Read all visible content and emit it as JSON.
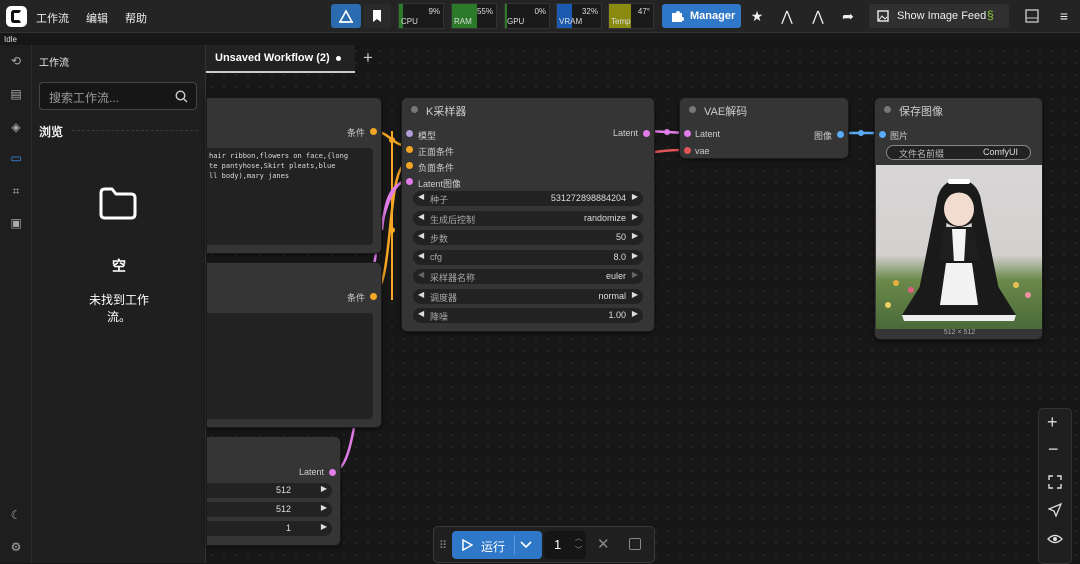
{
  "status": "Idle",
  "menu": {
    "workflow": "工作流",
    "edit": "编辑",
    "help": "帮助"
  },
  "stats": [
    {
      "label": "CPU",
      "value": "9%",
      "fill": 0.09,
      "color": "#2a7a2a"
    },
    {
      "label": "RAM",
      "value": "55%",
      "fill": 0.55,
      "color": "#2a7a2a"
    },
    {
      "label": "GPU",
      "value": "0%",
      "fill": 0.0,
      "color": "#2a7a2a"
    },
    {
      "label": "VRAM",
      "value": "32%",
      "fill": 0.32,
      "color": "#1a5ab0"
    },
    {
      "label": "Temp",
      "value": "47°",
      "fill": 0.47,
      "color": "#8a8a10"
    }
  ],
  "manager_label": "Manager",
  "feed_label": "Show Image Feed",
  "sidebar": {
    "title": "工作流",
    "search_placeholder": "搜索工作流...",
    "browse": "浏览",
    "empty_title": "空",
    "empty_message": "未找到工作流。"
  },
  "tab": {
    "title": "Unsaved Workflow (2)",
    "add": "+"
  },
  "nodes": {
    "ksampler": {
      "title": "K采样器",
      "inputs": [
        "模型",
        "正面条件",
        "负面条件",
        "Latent图像"
      ],
      "output": "Latent",
      "widgets": [
        {
          "name": "种子",
          "value": "531272898884204"
        },
        {
          "name": "生成后控制",
          "value": "randomize"
        },
        {
          "name": "步数",
          "value": "50"
        },
        {
          "name": "cfg",
          "value": "8.0"
        },
        {
          "name": "采样器名称",
          "value": "euler"
        },
        {
          "name": "调度器",
          "value": "normal"
        },
        {
          "name": "降噪",
          "value": "1.00"
        }
      ]
    },
    "vae": {
      "title": "VAE解码",
      "inputs": [
        "Latent",
        "vae"
      ],
      "output": "图像"
    },
    "save": {
      "title": "保存图像",
      "input": "图片",
      "prefix_label": "文件名前缀",
      "prefix_value": "ComfyUI",
      "caption": "512 × 512"
    },
    "pos": {
      "output": "条件",
      "text": "hair ribbon,flowers on face,{long\nte pantyhose,Skirt pleats,blue\nll body),mary janes"
    },
    "neg": {
      "output": "条件"
    },
    "latent": {
      "output": "Latent",
      "widgets": [
        "512",
        "512",
        "1"
      ]
    }
  },
  "run": {
    "label": "运行",
    "count": "1"
  }
}
